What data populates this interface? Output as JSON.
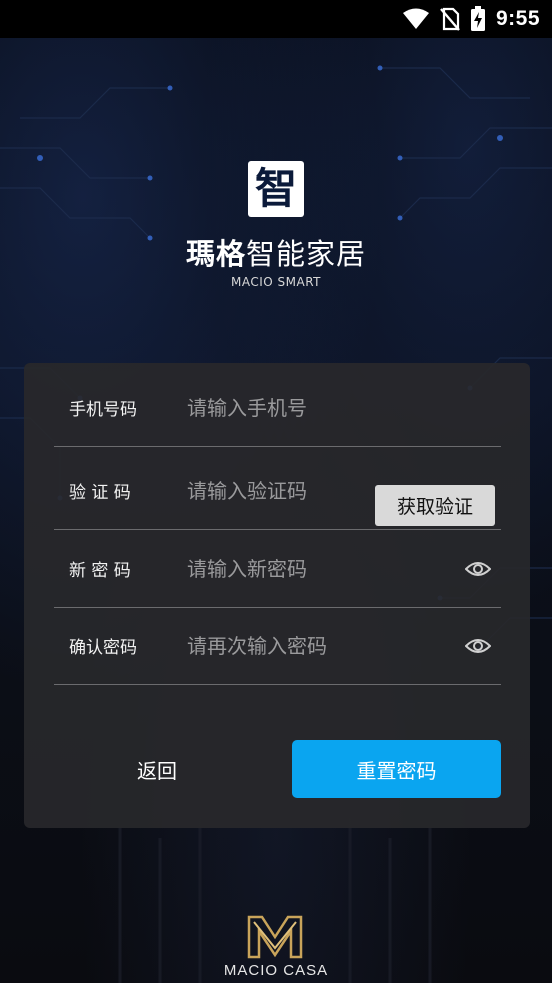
{
  "status_bar": {
    "time": "9:55"
  },
  "brand": {
    "logo_char": "智",
    "title_bold": "瑪格",
    "title_rest": "智能家居",
    "subtitle": "MACIO SMART"
  },
  "form": {
    "phone": {
      "label": "手机号码",
      "placeholder": "请输入手机号",
      "value": ""
    },
    "code": {
      "label": "验 证 码",
      "placeholder": "请输入验证码",
      "value": "",
      "button": "获取验证"
    },
    "new_password": {
      "label": "新 密 码",
      "placeholder": "请输入新密码",
      "value": ""
    },
    "confirm_password": {
      "label": "确认密码",
      "placeholder": "请再次输入密码",
      "value": ""
    }
  },
  "actions": {
    "back": "返回",
    "reset": "重置密码"
  },
  "footer": {
    "brand": "MACIO CASA"
  },
  "colors": {
    "accent": "#0aa5f0",
    "card": "#28282b",
    "gold": "#c9a45a"
  },
  "icons": [
    "wifi-icon",
    "no-sim-icon",
    "battery-charging-icon",
    "eye-icon"
  ]
}
